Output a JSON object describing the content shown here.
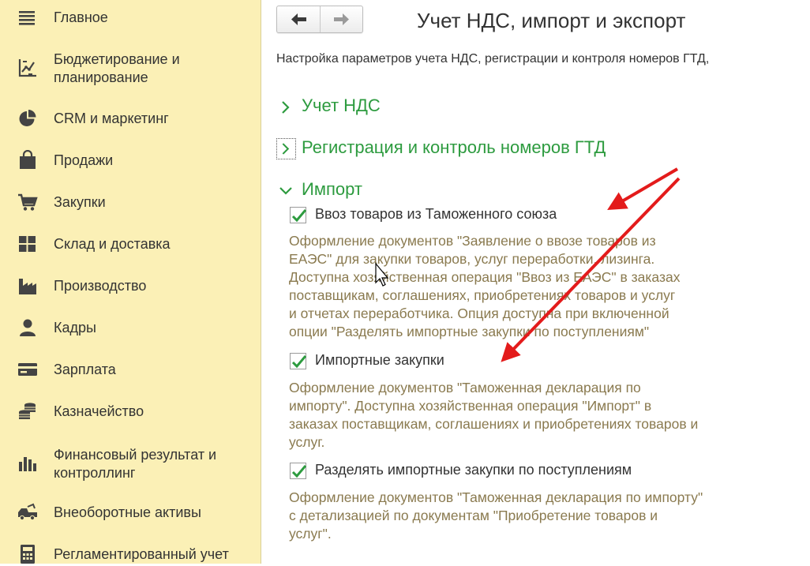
{
  "sidebar": {
    "items": [
      {
        "label": "Главное",
        "icon": "menu-icon"
      },
      {
        "label": "Бюджетирование и планирование",
        "icon": "budget-chart-icon"
      },
      {
        "label": "CRM и маркетинг",
        "icon": "pie-chart-icon"
      },
      {
        "label": "Продажи",
        "icon": "shopping-bag-icon"
      },
      {
        "label": "Закупки",
        "icon": "cart-icon"
      },
      {
        "label": "Склад и доставка",
        "icon": "warehouse-grid-icon"
      },
      {
        "label": "Производство",
        "icon": "factory-icon"
      },
      {
        "label": "Кадры",
        "icon": "person-icon"
      },
      {
        "label": "Зарплата",
        "icon": "card-icon"
      },
      {
        "label": "Казначейство",
        "icon": "coins-icon"
      },
      {
        "label": "Финансовый результат и контроллинг",
        "icon": "bar-chart-icon"
      },
      {
        "label": "Внеоборотные активы",
        "icon": "truck-icon"
      },
      {
        "label": "Регламентированный учет",
        "icon": "calculator-icon"
      }
    ]
  },
  "header": {
    "title": "Учет НДС, импорт и экспорт",
    "back_icon": "arrow-left-icon",
    "forward_icon": "arrow-right-icon"
  },
  "subtitle": "Настройка параметров учета НДС, регистрации и контроля номеров ГТД,",
  "sections": {
    "vat": {
      "label": "Учет НДС",
      "expanded": false
    },
    "gtd": {
      "label": "Регистрация и контроль номеров ГТД",
      "expanded": false
    },
    "import": {
      "label": "Импорт",
      "expanded": true
    }
  },
  "import_options": [
    {
      "label": "Ввоз товаров из Таможенного союза",
      "checked": true,
      "description": "Оформление документов \"Заявление о ввозе товаров из\nЕАЭС\" для закупки товаров, услуг переработки, лизинга.\nДоступна хозяйственная операция \"Ввоз из ЕАЭС\" в заказах\nпоставщикам, соглашениях, приобретениях товаров и услуг\nи отчетах переработчика. Опция доступна при включенной\nопции \"Разделять импортные закупки по поступлениям\""
    },
    {
      "label": "Импортные закупки",
      "checked": true,
      "description": "Оформление документов \"Таможенная декларация по\nимпорту\". Доступна хозяйственная операция \"Импорт\" в\nзаказах поставщикам, соглашениях и приобретениях товаров и\nуслуг."
    },
    {
      "label": "Разделять импортные закупки по поступлениям",
      "checked": true,
      "description": "Оформление документов \"Таможенная декларация по импорту\"\nс детализацией по документам \"Приобретение товаров и\nуслуг\"."
    }
  ],
  "colors": {
    "sidebar_bg": "#fbf0b6",
    "section_green": "#2d9b3f",
    "check_green": "#2d9b3f",
    "description_text": "#8a7a4f",
    "annotation_red": "#e31b1b"
  }
}
